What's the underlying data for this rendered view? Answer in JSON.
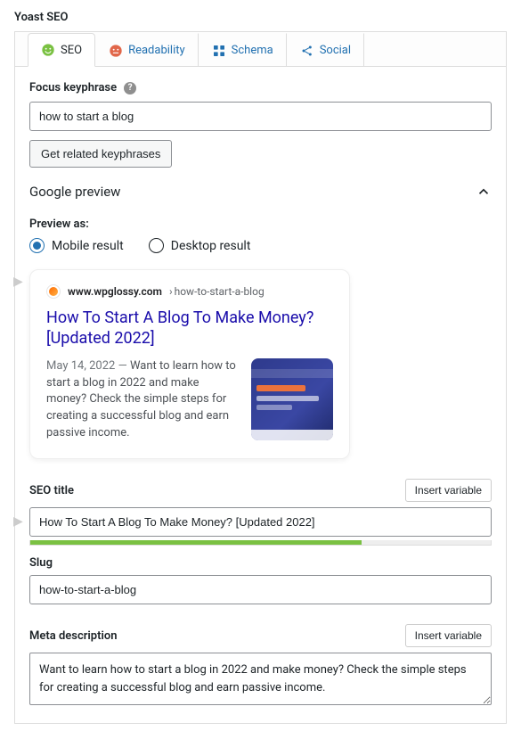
{
  "plugin_title": "Yoast SEO",
  "tabs": {
    "seo": "SEO",
    "readability": "Readability",
    "schema": "Schema",
    "social": "Social"
  },
  "focus_keyphrase": {
    "label": "Focus keyphrase",
    "value": "how to start a blog",
    "button": "Get related keyphrases"
  },
  "google_preview": {
    "heading": "Google preview",
    "preview_as_label": "Preview as:",
    "mobile_label": "Mobile result",
    "desktop_label": "Desktop result",
    "domain": "www.wpglossy.com",
    "path_sep": " › ",
    "path": "how-to-start-a-blog",
    "title": "How To Start A Blog To Make Money? [Updated 2022]",
    "date": "May 14, 2022",
    "separator": "—",
    "description": "Want to learn how to start a blog in 2022 and make money? Check the simple steps for creating a successful blog and earn passive income."
  },
  "seo_title": {
    "label": "SEO title",
    "insert_var": "Insert variable",
    "value": "How To Start A Blog To Make Money? [Updated 2022]"
  },
  "slug": {
    "label": "Slug",
    "value": "how-to-start-a-blog"
  },
  "meta_description": {
    "label": "Meta description",
    "insert_var": "Insert variable",
    "value": "Want to learn how to start a blog in 2022 and make money? Check the simple steps for creating a successful blog and earn passive income."
  }
}
